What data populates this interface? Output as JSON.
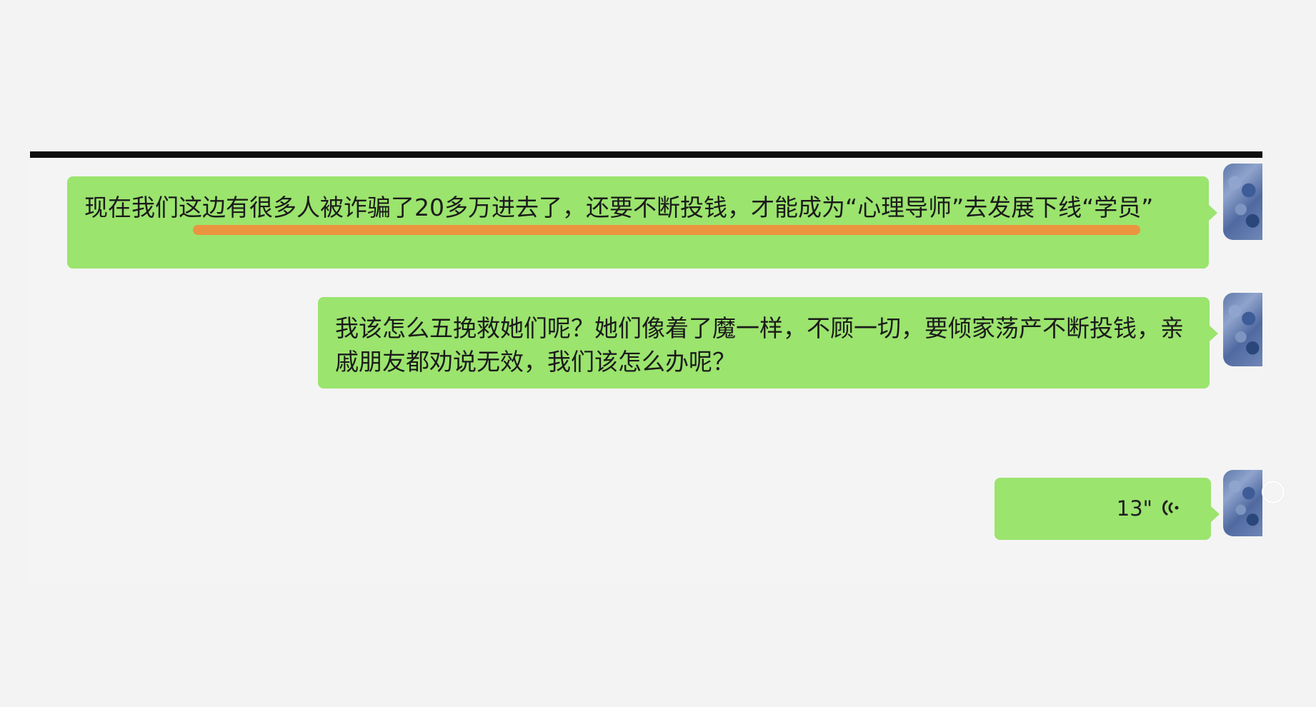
{
  "messages": [
    {
      "type": "text",
      "text": "现在我们这边有很多人被诈骗了20多万进去了，还要不断投钱，才能成为“心理导师”去发展下线“学员”"
    },
    {
      "type": "text",
      "text": "我该怎么五挽救她们呢？她们像着了魔一样，不顾一切，要倾家荡产不断投钱，亲戚朋友都劝说无效，我们该怎么办呢？"
    },
    {
      "type": "voice",
      "duration": "13\""
    }
  ],
  "colors": {
    "background": "#f3f3f3",
    "bubble": "#9be46e",
    "highlight": "#f28d3c",
    "divider": "#0d0d0d",
    "avatar": "#5f79ac"
  },
  "icons": {
    "voice": "voice-wave-icon",
    "scroll": "scroll-circle-icon"
  }
}
